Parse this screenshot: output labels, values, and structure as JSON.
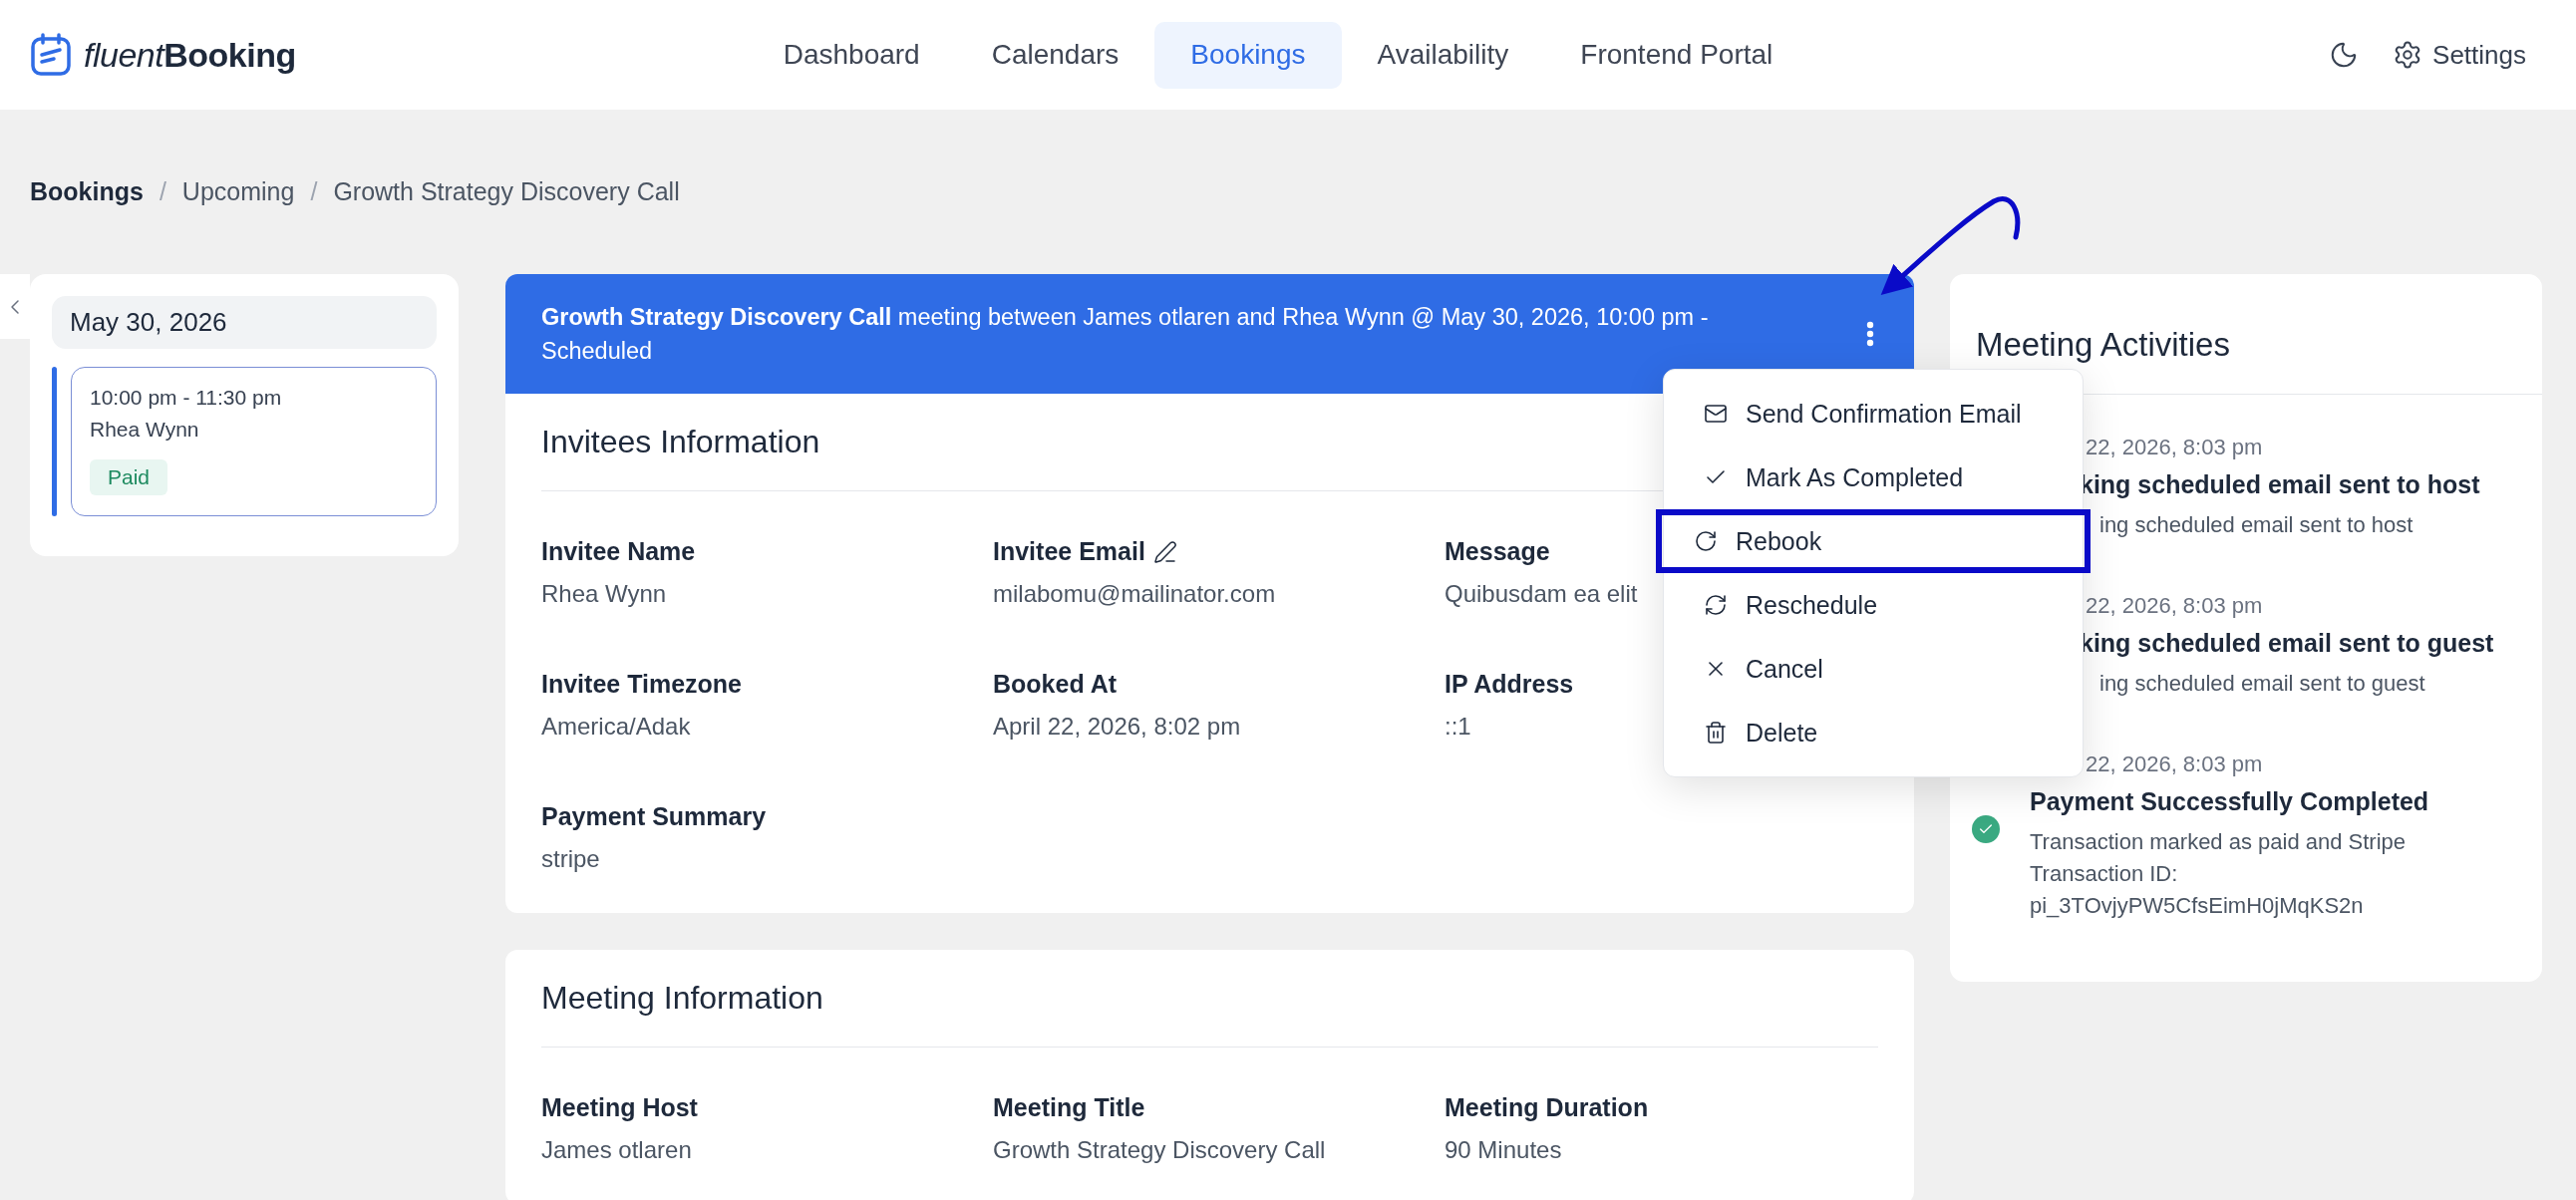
{
  "header": {
    "logo": {
      "light": "fluent",
      "bold": "Booking"
    },
    "nav": [
      {
        "label": "Dashboard",
        "selected": false
      },
      {
        "label": "Calendars",
        "selected": false
      },
      {
        "label": "Bookings",
        "selected": true
      },
      {
        "label": "Availability",
        "selected": false
      },
      {
        "label": "Frontend Portal",
        "selected": false
      }
    ],
    "settings": "Settings"
  },
  "breadcrumb": {
    "separator": "/",
    "items": [
      "Bookings",
      "Upcoming",
      "Growth Strategy Discovery Call"
    ]
  },
  "day_list": {
    "date": "May 30, 2026",
    "bookings": [
      {
        "time": "10:00 pm - 11:30 pm",
        "name": "Rhea Wynn",
        "badge": "Paid",
        "selected": true
      }
    ]
  },
  "banner": {
    "text": "**Growth Strategy Discovery Call** meeting between James otlaren and Rhea Wynn @ May 30, 2026, 10:00 pm - Scheduled"
  },
  "menu": {
    "items": [
      {
        "kind": "mail",
        "label": "Send Confirmation Email",
        "highlighted": false
      },
      {
        "kind": "check",
        "label": "Mark As Completed",
        "highlighted": false
      },
      {
        "kind": "rebook",
        "label": "Rebook",
        "highlighted": true
      },
      {
        "kind": "reschedule",
        "label": "Reschedule",
        "highlighted": false
      },
      {
        "kind": "cancel",
        "label": "Cancel",
        "highlighted": false
      },
      {
        "kind": "delete",
        "label": "Delete",
        "highlighted": false
      }
    ]
  },
  "invitees": {
    "title": "Invitees Information",
    "fields": [
      {
        "label": "Invitee Name",
        "value": "Rhea Wynn",
        "editable": false
      },
      {
        "label": "Invitee Email",
        "value": "milabomu@mailinator.com",
        "editable": true
      },
      {
        "label": "Message",
        "value": "Quibusdam ea elit",
        "editable": false
      },
      {
        "label": "Invitee Timezone",
        "value": "America/Adak",
        "editable": false
      },
      {
        "label": "Booked At",
        "value": "April 22, 2026, 8:02 pm",
        "editable": false
      },
      {
        "label": "IP Address",
        "value": "::1",
        "editable": false
      },
      {
        "label": "Payment Summary",
        "value": "stripe",
        "editable": false
      }
    ]
  },
  "meeting": {
    "title": "Meeting Information",
    "fields": [
      {
        "label": "Meeting Host",
        "value": "James otlaren"
      },
      {
        "label": "Meeting Title",
        "value": "Growth Strategy Discovery Call"
      },
      {
        "label": "Meeting Duration",
        "value": "90 Minutes"
      }
    ]
  },
  "activities": {
    "title": "Meeting Activities",
    "items": [
      {
        "kind": "partial",
        "date": "22, 2026, 8:03 pm",
        "title": "king scheduled email sent to host",
        "text": "ing scheduled email sent to host"
      },
      {
        "kind": "partial",
        "date": "22, 2026, 8:03 pm",
        "title": "king scheduled email sent to guest",
        "text": "ing scheduled email sent to guest"
      },
      {
        "kind": "full",
        "date": "22, 2026, 8:03 pm",
        "title": "Payment Successfully Completed",
        "text": "Transaction marked as paid and Stripe Transaction ID: pi_3TOvjyPW5CfsEimH0jMqKS2n",
        "color": "#3aa981"
      }
    ]
  }
}
